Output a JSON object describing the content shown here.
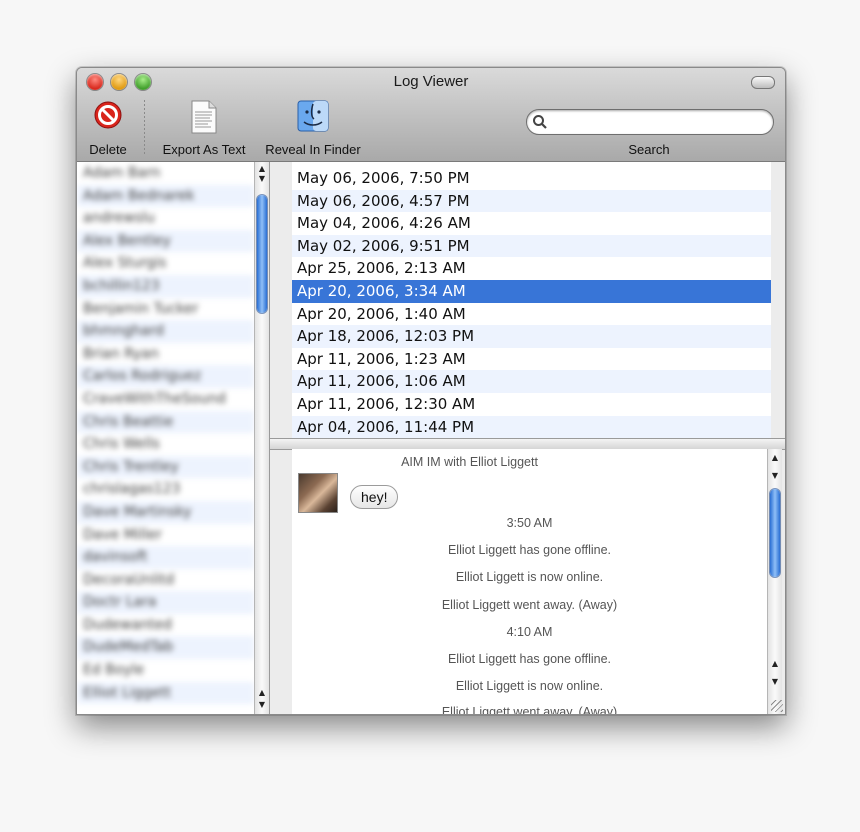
{
  "window": {
    "title": "Log Viewer"
  },
  "toolbar": {
    "delete_label": "Delete",
    "export_label": "Export As Text",
    "reveal_label": "Reveal In Finder",
    "search_label": "Search",
    "search_placeholder": ""
  },
  "contacts": [
    "Adam Barn",
    "Adam Bednarek",
    "andrewslu",
    "Alex Bentley",
    "Alex Sturgis",
    "bchillin123",
    "Benjamin Tucker",
    "bhmnghard",
    "Brian Ryan",
    "Carlos Rodriguez",
    "CraveWithTheSound",
    "Chris Beattie",
    "Chris Wells",
    "Chris Trentley",
    "chrislagas123",
    "Dave Martinsky",
    "Dave Miller",
    "davinsoft",
    "DecoraUnlitd",
    "Doctr Lara",
    "Dudewanted",
    "DudeMedTab",
    "Ed Boyle",
    "Elliot Liggett"
  ],
  "dates": [
    {
      "text": "May 06, 2006, 7:50 PM",
      "selected": false
    },
    {
      "text": "May 06, 2006, 4:57 PM",
      "selected": false
    },
    {
      "text": "May 04, 2006, 4:26 AM",
      "selected": false
    },
    {
      "text": "May 02, 2006, 9:51 PM",
      "selected": false
    },
    {
      "text": "Apr 25, 2006, 2:13 AM",
      "selected": false
    },
    {
      "text": "Apr 20, 2006, 3:34 AM",
      "selected": true
    },
    {
      "text": "Apr 20, 2006, 1:40 AM",
      "selected": false
    },
    {
      "text": "Apr 18, 2006, 12:03 PM",
      "selected": false
    },
    {
      "text": "Apr 11, 2006, 1:23 AM",
      "selected": false
    },
    {
      "text": "Apr 11, 2006, 1:06 AM",
      "selected": false
    },
    {
      "text": "Apr 11, 2006, 12:30 AM",
      "selected": false
    },
    {
      "text": "Apr 04, 2006, 11:44 PM",
      "selected": false
    }
  ],
  "transcript": {
    "header": "AIM IM with Elliot Liggett",
    "bubble": "hey!",
    "time1": "3:50 AM",
    "e1": "Elliot Liggett has gone offline.",
    "e2": "Elliot Liggett is now online.",
    "e3": "Elliot Liggett went away. (Away)",
    "time2": "4:10 AM",
    "e4": "Elliot Liggett has gone offline.",
    "e5": "Elliot Liggett is now online.",
    "e6": "Elliot Liggett went away. (Away)"
  },
  "colors": {
    "selection": "#3875d7",
    "alt_row": "#edf3fe"
  }
}
